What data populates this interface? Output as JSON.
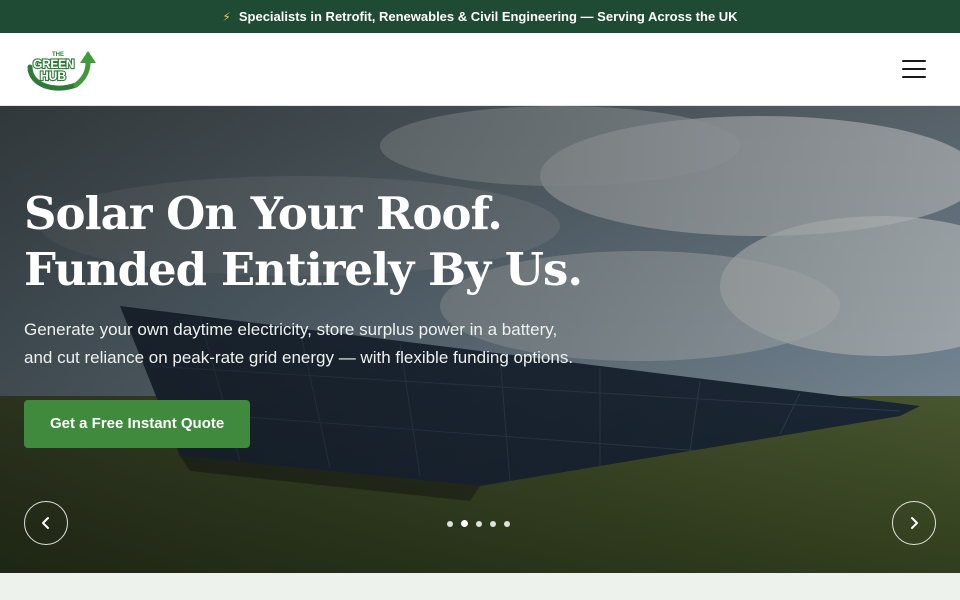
{
  "topbar": {
    "icon": "lightning-bolt-icon",
    "text": "Specialists in Retrofit, Renewables & Civil Engineering — Serving Across the UK"
  },
  "header": {
    "logo": {
      "the": "THE",
      "line1": "GREEN",
      "line2": "HUB"
    },
    "menu_icon": "hamburger-menu-icon"
  },
  "hero": {
    "title_line1": "Solar On Your Roof.",
    "title_line2": "Funded Entirely By Us.",
    "subtitle": "Generate your own daytime electricity, store surplus power in a battery, and cut reliance on peak-rate grid energy — with flexible funding options.",
    "cta_label": "Get a Free Instant Quote",
    "slides_total": 5,
    "active_slide": 2
  },
  "colors": {
    "topbar_bg": "#1f4a33",
    "brand_green": "#3f8a3c",
    "logo_green": "#2f7a39"
  }
}
